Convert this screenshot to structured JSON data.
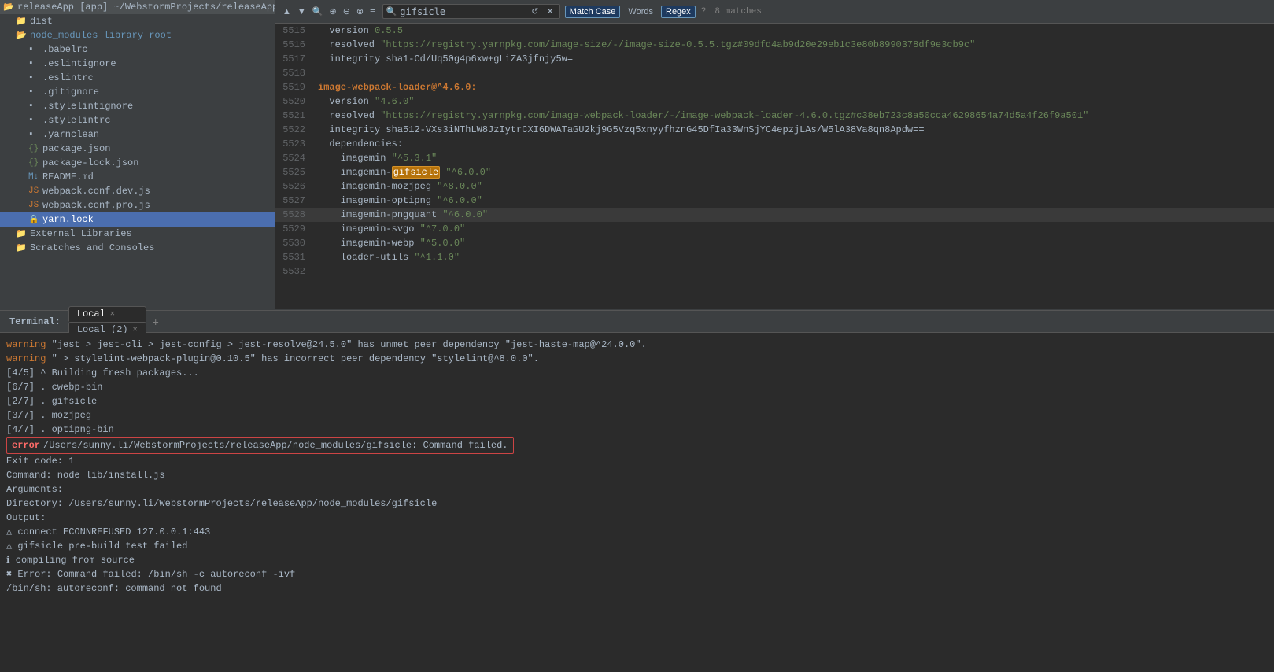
{
  "topbar": {
    "breadcrumb": "releaseApp [app] ~/WebstormProjects/releaseApp"
  },
  "sidebar": {
    "items": [
      {
        "id": "releaseapp",
        "label": "releaseApp [app]  ~/WebstormProjects/releaseApp",
        "indent": 0,
        "type": "folder-open",
        "expanded": true
      },
      {
        "id": "dist",
        "label": "dist",
        "indent": 1,
        "type": "folder",
        "expanded": false
      },
      {
        "id": "node_modules",
        "label": "node_modules  library root",
        "indent": 1,
        "type": "folder-open",
        "expanded": true,
        "highlight": true
      },
      {
        "id": "babelrc",
        "label": ".babelrc",
        "indent": 2,
        "type": "file"
      },
      {
        "id": "eslintignore",
        "label": ".eslintignore",
        "indent": 2,
        "type": "file"
      },
      {
        "id": "eslintrc",
        "label": ".eslintrc",
        "indent": 2,
        "type": "file"
      },
      {
        "id": "gitignore",
        "label": ".gitignore",
        "indent": 2,
        "type": "file"
      },
      {
        "id": "stylelintignore",
        "label": ".stylelintignore",
        "indent": 2,
        "type": "file"
      },
      {
        "id": "stylelintrc",
        "label": ".stylelintrc",
        "indent": 2,
        "type": "file"
      },
      {
        "id": "yarnclean",
        "label": ".yarnclean",
        "indent": 2,
        "type": "file"
      },
      {
        "id": "packagejson",
        "label": "package.json",
        "indent": 2,
        "type": "json"
      },
      {
        "id": "packagelockjson",
        "label": "package-lock.json",
        "indent": 2,
        "type": "json"
      },
      {
        "id": "readmemd",
        "label": "README.md",
        "indent": 2,
        "type": "md"
      },
      {
        "id": "webpackconfdev",
        "label": "webpack.conf.dev.js",
        "indent": 2,
        "type": "js"
      },
      {
        "id": "webpackconfpro",
        "label": "webpack.conf.pro.js",
        "indent": 2,
        "type": "js"
      },
      {
        "id": "yarnlock",
        "label": "yarn.lock",
        "indent": 2,
        "type": "lock",
        "selected": true
      },
      {
        "id": "externallibs",
        "label": "External Libraries",
        "indent": 1,
        "type": "folder",
        "expanded": false
      },
      {
        "id": "scratchesconsoles",
        "label": "Scratches and Consoles",
        "indent": 1,
        "type": "folder",
        "expanded": false
      }
    ]
  },
  "search": {
    "query": "gifsicle",
    "placeholder": "gifsicle",
    "match_case_label": "Match Case",
    "words_label": "Words",
    "regex_label": "Regex",
    "matches": "8 matches",
    "match_case_active": true,
    "regex_active": true
  },
  "editor": {
    "lines": [
      {
        "num": "5515",
        "content": "  version",
        "parts": [
          {
            "type": "field",
            "text": "  version"
          },
          {
            "type": "string",
            "text": " 0.5.5"
          }
        ]
      },
      {
        "num": "5516",
        "content": "  resolved",
        "parts": [
          {
            "type": "field",
            "text": "  resolved"
          },
          {
            "type": "url",
            "text": " \"https://registry.yarnpkg.com/image-size/-/image-size-0.5.5.tgz#09dfd4ab9d20e29eb1c3e80b8990378df9e3cb9c\""
          }
        ]
      },
      {
        "num": "5517",
        "content": "  integrity sha1-Cd/Uq50g4p6xw+gLiZA3jfnjy5w=",
        "parts": [
          {
            "type": "field",
            "text": "  integrity"
          },
          {
            "type": "plain",
            "text": " sha1-Cd/Uq50g4p6xw+gLiZA3jfnjy5w="
          }
        ]
      },
      {
        "num": "5518",
        "content": "",
        "parts": []
      },
      {
        "num": "5519",
        "content": "image-webpack-loader@^4.6.0:",
        "parts": [
          {
            "type": "bold",
            "text": "image-webpack-loader@^4.6.0:"
          }
        ]
      },
      {
        "num": "5520",
        "content": "  version \"4.6.0\"",
        "parts": [
          {
            "type": "field",
            "text": "  version"
          },
          {
            "type": "string",
            "text": " \"4.6.0\""
          }
        ]
      },
      {
        "num": "5521",
        "content": "  resolved",
        "parts": [
          {
            "type": "field",
            "text": "  resolved"
          },
          {
            "type": "url",
            "text": " \"https://registry.yarnpkg.com/image-webpack-loader/-/image-webpack-loader-4.6.0.tgz#c38eb723c8a50cca46298654a74d5a4f26f9a501\""
          }
        ]
      },
      {
        "num": "5522",
        "content": "  integrity sha512-VXs3iNThLW8JzIytrCXI6DWATaGU2kj9G5Vzq5xnyyfhznG45DfIa33WnSjYC4epzjLAs/W5lA38Va8qn8Apdw==",
        "parts": [
          {
            "type": "field",
            "text": "  integrity"
          },
          {
            "type": "plain",
            "text": " sha512-VXs3iNThLW8JzIytrCXI6DWATaGU2kj9G5Vzq5xnyyfhznG45DfIa33WnSjYC4epzjLAs/W5lA38Va8qn8Apdw=="
          }
        ]
      },
      {
        "num": "5523",
        "content": "  dependencies:",
        "parts": [
          {
            "type": "field",
            "text": "  dependencies:"
          }
        ]
      },
      {
        "num": "5524",
        "content": "    imagemin \"^5.3.1\"",
        "parts": [
          {
            "type": "field",
            "text": "    imagemin"
          },
          {
            "type": "string",
            "text": " \"^5.3.1\""
          }
        ]
      },
      {
        "num": "5525",
        "content": "    imagemin-gifsicle \"^6.0.0\"",
        "parts": [
          {
            "type": "field",
            "text": "    imagemin-"
          },
          {
            "type": "search-current",
            "text": "gifsicle"
          },
          {
            "type": "string",
            "text": " \"^6.0.0\""
          }
        ]
      },
      {
        "num": "5526",
        "content": "    imagemin-mozjpeg \"^8.0.0\"",
        "parts": [
          {
            "type": "field",
            "text": "    imagemin-mozjpeg"
          },
          {
            "type": "string",
            "text": " \"^8.0.0\""
          }
        ]
      },
      {
        "num": "5527",
        "content": "    imagemin-optipng \"^6.0.0\"",
        "parts": [
          {
            "type": "field",
            "text": "    imagemin-optipng"
          },
          {
            "type": "string",
            "text": " \"^6.0.0\""
          }
        ]
      },
      {
        "num": "5528",
        "content": "    imagemin-pngquant \"^6.0.0\"",
        "parts": [
          {
            "type": "field",
            "text": "    imagemin-pngquant"
          },
          {
            "type": "string",
            "text": " \"^6.0.0\""
          }
        ]
      },
      {
        "num": "5529",
        "content": "    imagemin-svgo \"^7.0.0\"",
        "parts": [
          {
            "type": "field",
            "text": "    imagemin-svgo"
          },
          {
            "type": "string",
            "text": " \"^7.0.0\""
          }
        ]
      },
      {
        "num": "5530",
        "content": "    imagemin-webp \"^5.0.0\"",
        "parts": [
          {
            "type": "field",
            "text": "    imagemin-webp"
          },
          {
            "type": "string",
            "text": " \"^5.0.0\""
          }
        ]
      },
      {
        "num": "5531",
        "content": "    loader-utils \"^1.1.0\"",
        "parts": [
          {
            "type": "field",
            "text": "    loader-utils"
          },
          {
            "type": "string",
            "text": " \"^1.1.0\""
          }
        ]
      },
      {
        "num": "5532",
        "content": "",
        "parts": []
      }
    ]
  },
  "terminal": {
    "label": "Terminal:",
    "tabs": [
      {
        "id": "local",
        "label": "Local",
        "active": true,
        "closable": true
      },
      {
        "id": "local2",
        "label": "Local (2)",
        "active": false,
        "closable": true
      }
    ],
    "add_btn": "+",
    "lines": [
      {
        "type": "warning",
        "warning_label": "warning",
        "text": " \"jest > jest-cli > jest-config > jest-resolve@24.5.0\" has unmet peer dependency \"jest-haste-map@^24.0.0\"."
      },
      {
        "type": "warning",
        "warning_label": "warning",
        "text": " \" > stylelint-webpack-plugin@0.10.5\" has incorrect peer dependency \"stylelint@^8.0.0\"."
      },
      {
        "type": "info",
        "text": "[4/5] ^  Building fresh packages..."
      },
      {
        "type": "info",
        "text": "[6/7] .  cwebp-bin"
      },
      {
        "type": "info",
        "text": "[2/7] .  gifsicle"
      },
      {
        "type": "info",
        "text": "[3/7] .  mozjpeg"
      },
      {
        "type": "info",
        "text": "[4/7] .  optipng-bin"
      },
      {
        "type": "error",
        "error_label": "error",
        "text": " /Users/sunny.li/WebstormProjects/releaseApp/node_modules/gifsicle: Command failed."
      },
      {
        "type": "plain",
        "text": "Exit code: 1"
      },
      {
        "type": "plain",
        "text": "Command: node lib/install.js"
      },
      {
        "type": "plain",
        "text": "Arguments:"
      },
      {
        "type": "plain",
        "text": "Directory: /Users/sunny.li/WebstormProjects/releaseApp/node_modules/gifsicle"
      },
      {
        "type": "plain",
        "text": "Output:"
      },
      {
        "type": "plain",
        "text": "△ connect ECONNREFUSED 127.0.0.1:443"
      },
      {
        "type": "plain",
        "text": "  △ gifsicle pre-build test failed"
      },
      {
        "type": "plain",
        "text": "  ℹ compiling from source"
      },
      {
        "type": "plain",
        "text": "  ✖ Error: Command failed: /bin/sh -c autoreconf -ivf"
      },
      {
        "type": "plain",
        "text": "/bin/sh: autoreconf: command not found"
      }
    ]
  }
}
